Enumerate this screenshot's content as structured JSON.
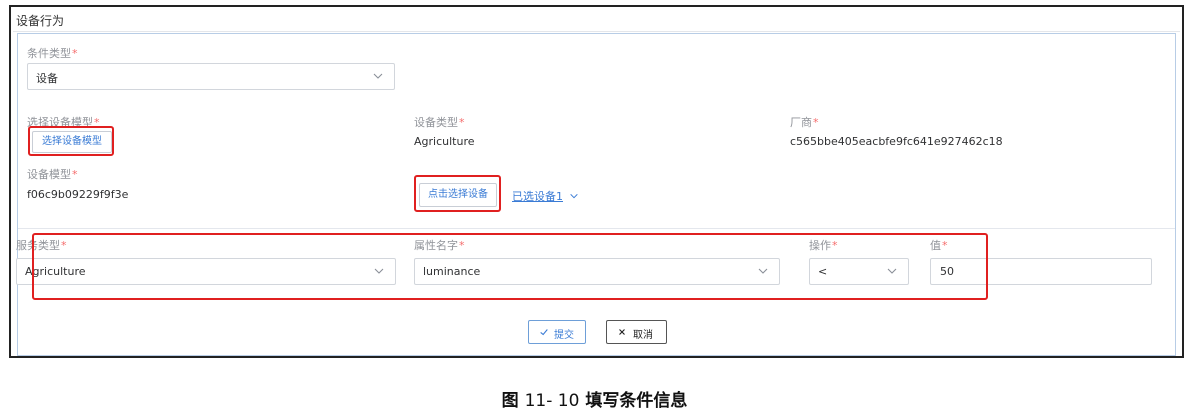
{
  "section_title": "设备行为",
  "required_mark": "*",
  "condition_type": {
    "label": "条件类型",
    "value": "设备"
  },
  "select_model": {
    "label": "选择设备模型",
    "button": "选择设备模型"
  },
  "device_type": {
    "label": "设备类型",
    "value": "Agriculture"
  },
  "vendor": {
    "label": "厂商",
    "value": "c565bbe405eacbfe9fc641e927462c18"
  },
  "device_model": {
    "label": "设备模型",
    "value": "f06c9b09229f9f3e"
  },
  "choose_device": {
    "button": "点击选择设备",
    "selected_link": "已选设备1"
  },
  "service_type": {
    "label": "服务类型",
    "value": "Agriculture"
  },
  "property_name": {
    "label": "属性名字",
    "value": "luminance"
  },
  "operation": {
    "label": "操作",
    "value": "<"
  },
  "threshold": {
    "label": "值",
    "value": "50"
  },
  "actions": {
    "submit": "提交",
    "cancel": "取消"
  },
  "caption": {
    "figure": "图",
    "number": "11- 10",
    "title": "填写条件信息"
  },
  "colors": {
    "highlight": "#e02020",
    "link": "#3a7bd5",
    "required": "#f56c6c",
    "panel_border": "#b8cde6"
  }
}
